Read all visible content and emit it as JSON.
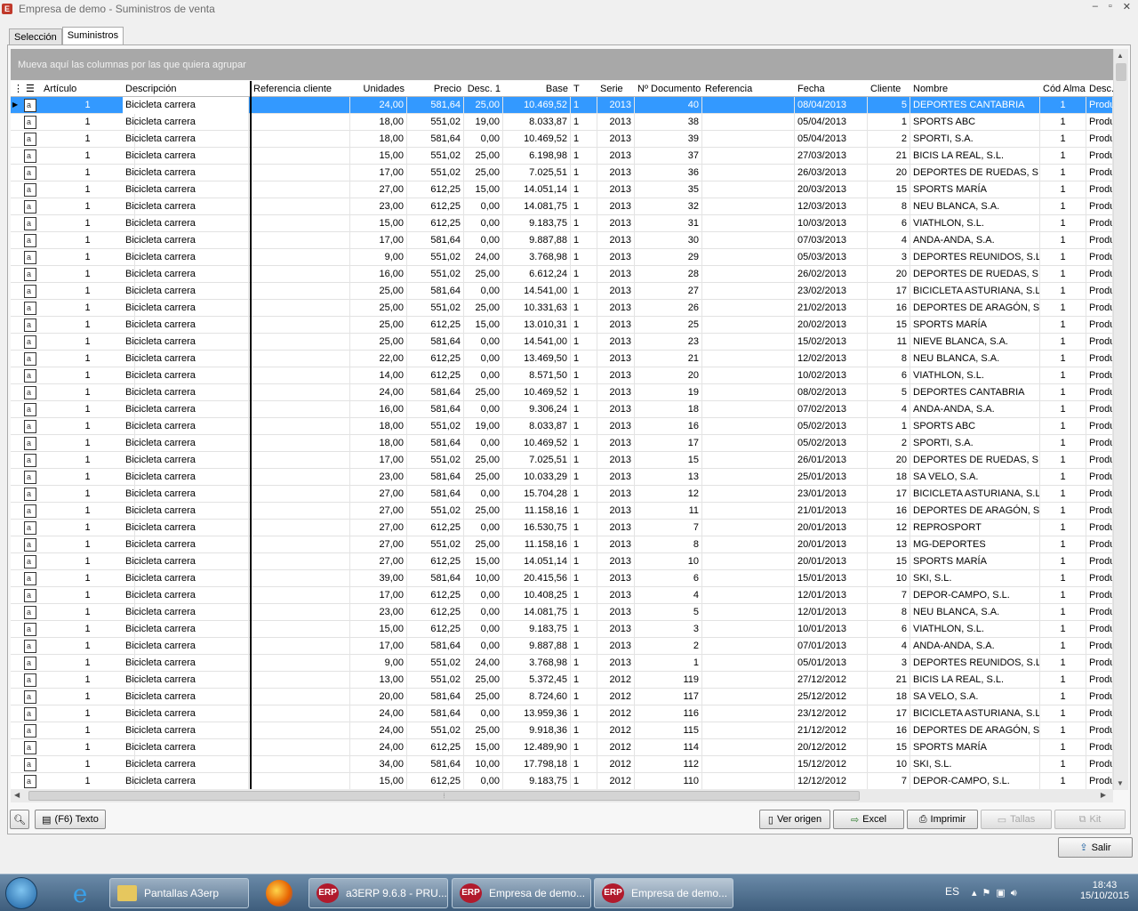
{
  "window": {
    "title": "Empresa de demo - Suministros de venta",
    "app_icon": "E",
    "controls": [
      "–",
      "▫",
      "✕"
    ]
  },
  "tabs": [
    {
      "label": "Selección",
      "active": false
    },
    {
      "label": "Suministros",
      "active": true
    }
  ],
  "group_bar": {
    "text": "Mueva aquí las columnas por las que quiera agrupar"
  },
  "columns": [
    "Artículo",
    "Descripción",
    "Referencia cliente",
    "Unidades",
    "Precio",
    "Desc. 1",
    "Base",
    "T",
    "Serie",
    "Nº Documento",
    "Referencia",
    "Fecha",
    "Cliente",
    "Nombre",
    "Cód Alma",
    "Desc."
  ],
  "rows": [
    [
      "1",
      "Bicicleta carrera",
      "",
      "24,00",
      "581,64",
      "25,00",
      "10.469,52",
      "1",
      "2013",
      "40",
      "",
      "08/04/2013",
      "5",
      "DEPORTES CANTABRIA",
      "1",
      "Produ"
    ],
    [
      "1",
      "Bicicleta carrera",
      "",
      "18,00",
      "551,02",
      "19,00",
      "8.033,87",
      "1",
      "2013",
      "38",
      "",
      "05/04/2013",
      "1",
      "SPORTS ABC",
      "1",
      "Produ"
    ],
    [
      "1",
      "Bicicleta carrera",
      "",
      "18,00",
      "581,64",
      "0,00",
      "10.469,52",
      "1",
      "2013",
      "39",
      "",
      "05/04/2013",
      "2",
      "SPORTI, S.A.",
      "1",
      "Produ"
    ],
    [
      "1",
      "Bicicleta carrera",
      "",
      "15,00",
      "551,02",
      "25,00",
      "6.198,98",
      "1",
      "2013",
      "37",
      "",
      "27/03/2013",
      "21",
      "BICIS LA REAL, S.L.",
      "1",
      "Produ"
    ],
    [
      "1",
      "Bicicleta carrera",
      "",
      "17,00",
      "551,02",
      "25,00",
      "7.025,51",
      "1",
      "2013",
      "36",
      "",
      "26/03/2013",
      "20",
      "DEPORTES DE RUEDAS, S.L.",
      "1",
      "Produ"
    ],
    [
      "1",
      "Bicicleta carrera",
      "",
      "27,00",
      "612,25",
      "15,00",
      "14.051,14",
      "1",
      "2013",
      "35",
      "",
      "20/03/2013",
      "15",
      "SPORTS MARÍA",
      "1",
      "Produ"
    ],
    [
      "1",
      "Bicicleta carrera",
      "",
      "23,00",
      "612,25",
      "0,00",
      "14.081,75",
      "1",
      "2013",
      "32",
      "",
      "12/03/2013",
      "8",
      "NEU BLANCA, S.A.",
      "1",
      "Produ"
    ],
    [
      "1",
      "Bicicleta carrera",
      "",
      "15,00",
      "612,25",
      "0,00",
      "9.183,75",
      "1",
      "2013",
      "31",
      "",
      "10/03/2013",
      "6",
      "VIATHLON, S.L.",
      "1",
      "Produ"
    ],
    [
      "1",
      "Bicicleta carrera",
      "",
      "17,00",
      "581,64",
      "0,00",
      "9.887,88",
      "1",
      "2013",
      "30",
      "",
      "07/03/2013",
      "4",
      "ANDA-ANDA, S.A.",
      "1",
      "Produ"
    ],
    [
      "1",
      "Bicicleta carrera",
      "",
      "9,00",
      "551,02",
      "24,00",
      "3.768,98",
      "1",
      "2013",
      "29",
      "",
      "05/03/2013",
      "3",
      "DEPORTES REUNIDOS, S.L.",
      "1",
      "Produ"
    ],
    [
      "1",
      "Bicicleta carrera",
      "",
      "16,00",
      "551,02",
      "25,00",
      "6.612,24",
      "1",
      "2013",
      "28",
      "",
      "26/02/2013",
      "20",
      "DEPORTES DE RUEDAS, S.L.",
      "1",
      "Produ"
    ],
    [
      "1",
      "Bicicleta carrera",
      "",
      "25,00",
      "581,64",
      "0,00",
      "14.541,00",
      "1",
      "2013",
      "27",
      "",
      "23/02/2013",
      "17",
      "BICICLETA ASTURIANA, S.L.",
      "1",
      "Produ"
    ],
    [
      "1",
      "Bicicleta carrera",
      "",
      "25,00",
      "551,02",
      "25,00",
      "10.331,63",
      "1",
      "2013",
      "26",
      "",
      "21/02/2013",
      "16",
      "DEPORTES DE ARAGÓN, S.L.",
      "1",
      "Produ"
    ],
    [
      "1",
      "Bicicleta carrera",
      "",
      "25,00",
      "612,25",
      "15,00",
      "13.010,31",
      "1",
      "2013",
      "25",
      "",
      "20/02/2013",
      "15",
      "SPORTS MARÍA",
      "1",
      "Produ"
    ],
    [
      "1",
      "Bicicleta carrera",
      "",
      "25,00",
      "581,64",
      "0,00",
      "14.541,00",
      "1",
      "2013",
      "23",
      "",
      "15/02/2013",
      "11",
      "NIEVE BLANCA, S.A.",
      "1",
      "Produ"
    ],
    [
      "1",
      "Bicicleta carrera",
      "",
      "22,00",
      "612,25",
      "0,00",
      "13.469,50",
      "1",
      "2013",
      "21",
      "",
      "12/02/2013",
      "8",
      "NEU BLANCA, S.A.",
      "1",
      "Produ"
    ],
    [
      "1",
      "Bicicleta carrera",
      "",
      "14,00",
      "612,25",
      "0,00",
      "8.571,50",
      "1",
      "2013",
      "20",
      "",
      "10/02/2013",
      "6",
      "VIATHLON, S.L.",
      "1",
      "Produ"
    ],
    [
      "1",
      "Bicicleta carrera",
      "",
      "24,00",
      "581,64",
      "25,00",
      "10.469,52",
      "1",
      "2013",
      "19",
      "",
      "08/02/2013",
      "5",
      "DEPORTES CANTABRIA",
      "1",
      "Produ"
    ],
    [
      "1",
      "Bicicleta carrera",
      "",
      "16,00",
      "581,64",
      "0,00",
      "9.306,24",
      "1",
      "2013",
      "18",
      "",
      "07/02/2013",
      "4",
      "ANDA-ANDA, S.A.",
      "1",
      "Produ"
    ],
    [
      "1",
      "Bicicleta carrera",
      "",
      "18,00",
      "551,02",
      "19,00",
      "8.033,87",
      "1",
      "2013",
      "16",
      "",
      "05/02/2013",
      "1",
      "SPORTS ABC",
      "1",
      "Produ"
    ],
    [
      "1",
      "Bicicleta carrera",
      "",
      "18,00",
      "581,64",
      "0,00",
      "10.469,52",
      "1",
      "2013",
      "17",
      "",
      "05/02/2013",
      "2",
      "SPORTI, S.A.",
      "1",
      "Produ"
    ],
    [
      "1",
      "Bicicleta carrera",
      "",
      "17,00",
      "551,02",
      "25,00",
      "7.025,51",
      "1",
      "2013",
      "15",
      "",
      "26/01/2013",
      "20",
      "DEPORTES DE RUEDAS, S.L.",
      "1",
      "Produ"
    ],
    [
      "1",
      "Bicicleta carrera",
      "",
      "23,00",
      "581,64",
      "25,00",
      "10.033,29",
      "1",
      "2013",
      "13",
      "",
      "25/01/2013",
      "18",
      "SA VELO, S.A.",
      "1",
      "Produ"
    ],
    [
      "1",
      "Bicicleta carrera",
      "",
      "27,00",
      "581,64",
      "0,00",
      "15.704,28",
      "1",
      "2013",
      "12",
      "",
      "23/01/2013",
      "17",
      "BICICLETA ASTURIANA, S.L.",
      "1",
      "Produ"
    ],
    [
      "1",
      "Bicicleta carrera",
      "",
      "27,00",
      "551,02",
      "25,00",
      "11.158,16",
      "1",
      "2013",
      "11",
      "",
      "21/01/2013",
      "16",
      "DEPORTES DE ARAGÓN, S.L.",
      "1",
      "Produ"
    ],
    [
      "1",
      "Bicicleta carrera",
      "",
      "27,00",
      "612,25",
      "0,00",
      "16.530,75",
      "1",
      "2013",
      "7",
      "",
      "20/01/2013",
      "12",
      "REPROSPORT",
      "1",
      "Produ"
    ],
    [
      "1",
      "Bicicleta carrera",
      "",
      "27,00",
      "551,02",
      "25,00",
      "11.158,16",
      "1",
      "2013",
      "8",
      "",
      "20/01/2013",
      "13",
      "MG-DEPORTES",
      "1",
      "Produ"
    ],
    [
      "1",
      "Bicicleta carrera",
      "",
      "27,00",
      "612,25",
      "15,00",
      "14.051,14",
      "1",
      "2013",
      "10",
      "",
      "20/01/2013",
      "15",
      "SPORTS MARÍA",
      "1",
      "Produ"
    ],
    [
      "1",
      "Bicicleta carrera",
      "",
      "39,00",
      "581,64",
      "10,00",
      "20.415,56",
      "1",
      "2013",
      "6",
      "",
      "15/01/2013",
      "10",
      "SKI, S.L.",
      "1",
      "Produ"
    ],
    [
      "1",
      "Bicicleta carrera",
      "",
      "17,00",
      "612,25",
      "0,00",
      "10.408,25",
      "1",
      "2013",
      "4",
      "",
      "12/01/2013",
      "7",
      "DEPOR-CAMPO, S.L.",
      "1",
      "Produ"
    ],
    [
      "1",
      "Bicicleta carrera",
      "",
      "23,00",
      "612,25",
      "0,00",
      "14.081,75",
      "1",
      "2013",
      "5",
      "",
      "12/01/2013",
      "8",
      "NEU BLANCA, S.A.",
      "1",
      "Produ"
    ],
    [
      "1",
      "Bicicleta carrera",
      "",
      "15,00",
      "612,25",
      "0,00",
      "9.183,75",
      "1",
      "2013",
      "3",
      "",
      "10/01/2013",
      "6",
      "VIATHLON, S.L.",
      "1",
      "Produ"
    ],
    [
      "1",
      "Bicicleta carrera",
      "",
      "17,00",
      "581,64",
      "0,00",
      "9.887,88",
      "1",
      "2013",
      "2",
      "",
      "07/01/2013",
      "4",
      "ANDA-ANDA, S.A.",
      "1",
      "Produ"
    ],
    [
      "1",
      "Bicicleta carrera",
      "",
      "9,00",
      "551,02",
      "24,00",
      "3.768,98",
      "1",
      "2013",
      "1",
      "",
      "05/01/2013",
      "3",
      "DEPORTES REUNIDOS, S.L.",
      "1",
      "Produ"
    ],
    [
      "1",
      "Bicicleta carrera",
      "",
      "13,00",
      "551,02",
      "25,00",
      "5.372,45",
      "1",
      "2012",
      "119",
      "",
      "27/12/2012",
      "21",
      "BICIS LA REAL, S.L.",
      "1",
      "Produ"
    ],
    [
      "1",
      "Bicicleta carrera",
      "",
      "20,00",
      "581,64",
      "25,00",
      "8.724,60",
      "1",
      "2012",
      "117",
      "",
      "25/12/2012",
      "18",
      "SA VELO, S.A.",
      "1",
      "Produ"
    ],
    [
      "1",
      "Bicicleta carrera",
      "",
      "24,00",
      "581,64",
      "0,00",
      "13.959,36",
      "1",
      "2012",
      "116",
      "",
      "23/12/2012",
      "17",
      "BICICLETA ASTURIANA, S.L.",
      "1",
      "Produ"
    ],
    [
      "1",
      "Bicicleta carrera",
      "",
      "24,00",
      "551,02",
      "25,00",
      "9.918,36",
      "1",
      "2012",
      "115",
      "",
      "21/12/2012",
      "16",
      "DEPORTES DE ARAGÓN, S.L.",
      "1",
      "Produ"
    ],
    [
      "1",
      "Bicicleta carrera",
      "",
      "24,00",
      "612,25",
      "15,00",
      "12.489,90",
      "1",
      "2012",
      "114",
      "",
      "20/12/2012",
      "15",
      "SPORTS MARÍA",
      "1",
      "Produ"
    ],
    [
      "1",
      "Bicicleta carrera",
      "",
      "34,00",
      "581,64",
      "10,00",
      "17.798,18",
      "1",
      "2012",
      "112",
      "",
      "15/12/2012",
      "10",
      "SKI, S.L.",
      "1",
      "Produ"
    ],
    [
      "1",
      "Bicicleta carrera",
      "",
      "15,00",
      "612,25",
      "0,00",
      "9.183,75",
      "1",
      "2012",
      "110",
      "",
      "12/12/2012",
      "7",
      "DEPOR-CAMPO, S.L.",
      "1",
      "Produ"
    ]
  ],
  "buttons": {
    "search": "",
    "texto": "(F6) Texto",
    "ver_origen": "Ver origen",
    "excel": "Excel",
    "imprimir": "Imprimir",
    "tallas": "Tallas",
    "kit": "Kit",
    "salir": "Salir"
  },
  "taskbar": {
    "items": [
      {
        "label": "Pantallas A3erp",
        "icon": "folder-icon"
      },
      {
        "label": "a3ERP 9.6.8 - PRU...",
        "icon": "erp-icon"
      },
      {
        "label": "Empresa de demo...",
        "icon": "erp-icon"
      },
      {
        "label": "Empresa de demo...",
        "icon": "erp-icon"
      }
    ],
    "erp_icon_text": "ERP",
    "lang": "ES",
    "time": "18:43",
    "date": "15/10/2015"
  }
}
